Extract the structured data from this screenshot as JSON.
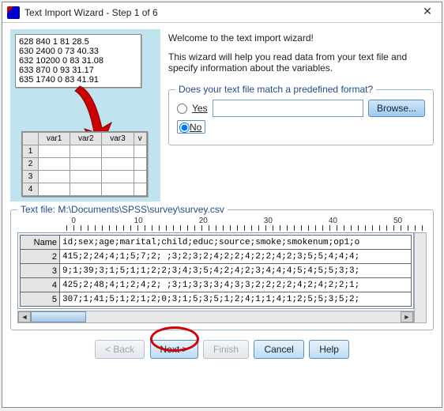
{
  "window_title": "Text Import Wizard - Step 1 of 6",
  "welcome": {
    "title": "Welcome to the text import wizard!",
    "body": "This wizard will help you read data from your text file and specify information about the variables."
  },
  "sample_lines": [
    "628 840 1 81 28.5",
    "630 2400 0 73 40.33",
    "632 10200 0 83 31.08",
    "633 870 0 93 31.17",
    "635 1740 0 83 41.91"
  ],
  "grid_headers": [
    "var1",
    "var2",
    "var3",
    "v"
  ],
  "grid_rows": [
    "1",
    "2",
    "3",
    "4"
  ],
  "format_group": {
    "legend": "Does your text file match a predefined format?",
    "yes": "Yes",
    "no": "No",
    "browse": "Browse...",
    "selected": "no"
  },
  "preview": {
    "legend_prefix": "Text file:  ",
    "path": "M:\\Documents\\SPSS\\survey\\survey.csv",
    "ruler_marks": [
      "0",
      "10",
      "20",
      "30",
      "40",
      "50"
    ],
    "row_headers": [
      "Name",
      "2",
      "3",
      "4",
      "5"
    ],
    "rows": [
      "id;sex;age;marital;child;educ;source;smoke;smokenum;op1;o",
      "415;2;24;4;1;5;7;2; ;3;2;3;2;4;2;2;4;2;2;4;2;3;5;5;4;4;4;",
      "9;1;39;3;1;5;1;1;2;2;3;4;3;5;4;2;4;2;3;4;4;4;5;4;5;5;3;3;",
      "425;2;48;4;1;2;4;2; ;3;1;3;3;3;4;3;3;2;2;2;2;4;2;4;2;2;1;",
      "307;1;41;5;1;2;1;2;0;3;1;5;3;5;1;2;4;1;1;4;1;2;5;5;3;5;2;"
    ]
  },
  "buttons": {
    "back": "< Back",
    "next": "Next >",
    "finish": "Finish",
    "cancel": "Cancel",
    "help": "Help"
  }
}
